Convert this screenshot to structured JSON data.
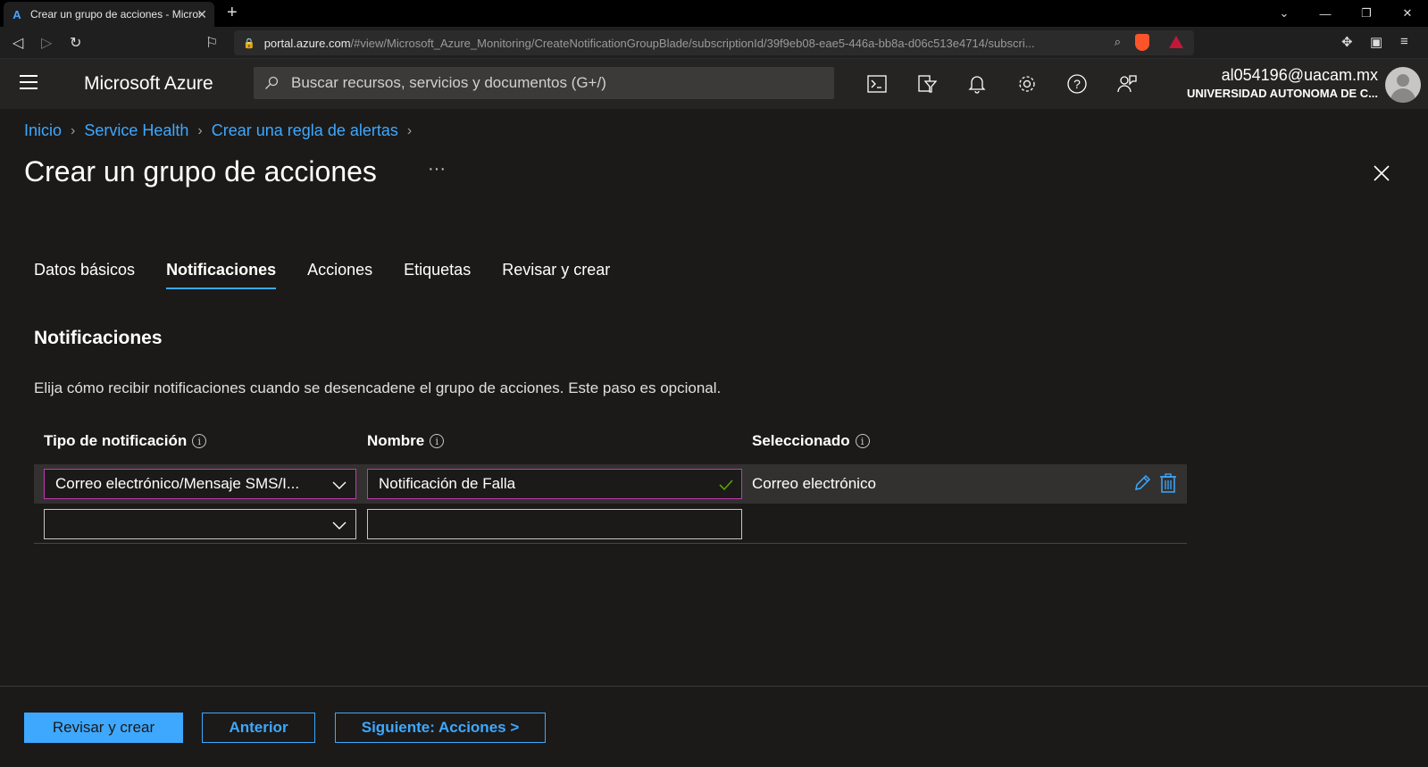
{
  "browser": {
    "tab_title": "Crear un grupo de acciones - Microsoft Azure",
    "url_host": "portal.azure.com",
    "url_path": "/#view/Microsoft_Azure_Monitoring/CreateNotificationGroupBlade/subscriptionId/39f9eb08-eae5-446a-bb8a-d06c513e4714/subscri..."
  },
  "header": {
    "brand": "Microsoft Azure",
    "search_placeholder": "Buscar recursos, servicios y documentos (G+/)",
    "account_email": "al054196@uacam.mx",
    "account_org": "UNIVERSIDAD AUTONOMA DE C..."
  },
  "breadcrumb": [
    "Inicio",
    "Service Health",
    "Crear una regla de alertas"
  ],
  "page": {
    "title": "Crear un grupo de acciones",
    "more": "···"
  },
  "tabs": [
    {
      "label": "Datos básicos",
      "active": false
    },
    {
      "label": "Notificaciones",
      "active": true
    },
    {
      "label": "Acciones",
      "active": false
    },
    {
      "label": "Etiquetas",
      "active": false
    },
    {
      "label": "Revisar y crear",
      "active": false
    }
  ],
  "section": {
    "title": "Notificaciones",
    "description": "Elija cómo recibir notificaciones cuando se desencadene el grupo de acciones. Este paso es opcional."
  },
  "grid": {
    "columns": [
      "Tipo de notificación",
      "Nombre",
      "Seleccionado"
    ],
    "rows": [
      {
        "type": "Correo electrónico/Mensaje SMS/I...",
        "name": "Notificación de Falla",
        "selected": "Correo electrónico"
      },
      {
        "type": "",
        "name": "",
        "selected": ""
      }
    ]
  },
  "footer": {
    "review_create": "Revisar y crear",
    "previous": "Anterior",
    "next": "Siguiente: Acciones >"
  },
  "colors": {
    "accent": "#3ea8ff",
    "focus_border": "#c239b3",
    "background": "#1b1a19",
    "header": "#252423"
  }
}
